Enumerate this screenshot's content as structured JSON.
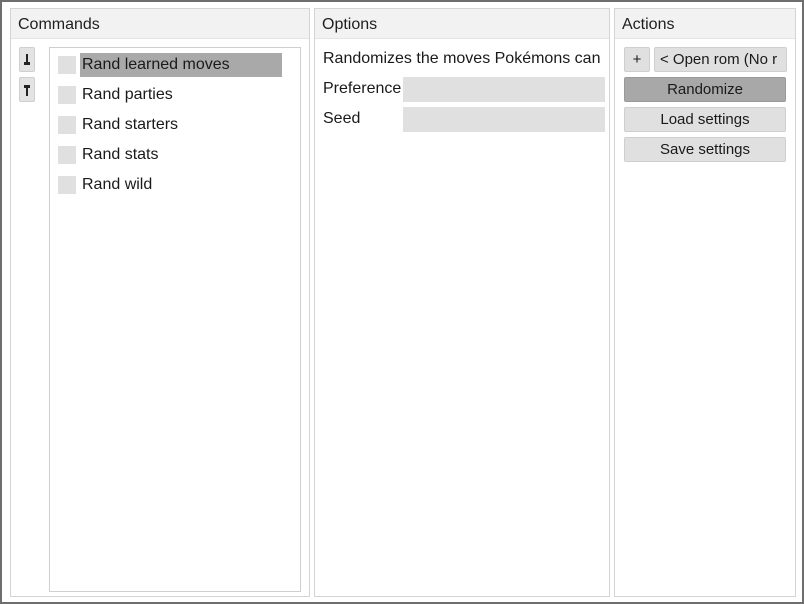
{
  "panels": {
    "commands": {
      "title": "Commands",
      "items": [
        {
          "label": "Rand learned moves",
          "checked": false,
          "selected": true
        },
        {
          "label": "Rand parties",
          "checked": false,
          "selected": false
        },
        {
          "label": "Rand starters",
          "checked": false,
          "selected": false
        },
        {
          "label": "Rand stats",
          "checked": false,
          "selected": false
        },
        {
          "label": "Rand wild",
          "checked": false,
          "selected": false
        }
      ]
    },
    "options": {
      "title": "Options",
      "description": "Randomizes the moves Pokémons can",
      "preference_label": "Preference",
      "preference_value": "",
      "seed_label": "Seed",
      "seed_value": ""
    },
    "actions": {
      "title": "Actions",
      "plus_label": "+",
      "open_rom_label": "< Open rom (No r",
      "randomize_label": "Randomize",
      "load_settings_label": "Load settings",
      "save_settings_label": "Save settings"
    }
  },
  "icons": {
    "move_up": "arrow-up-icon",
    "move_down": "arrow-down-icon"
  },
  "colors": {
    "panel_header_bg": "#f2f2f2",
    "selected_item_bg": "#a9a9a9",
    "field_bg": "#e0e0e0",
    "primary_button_bg": "#a8a8a8"
  }
}
